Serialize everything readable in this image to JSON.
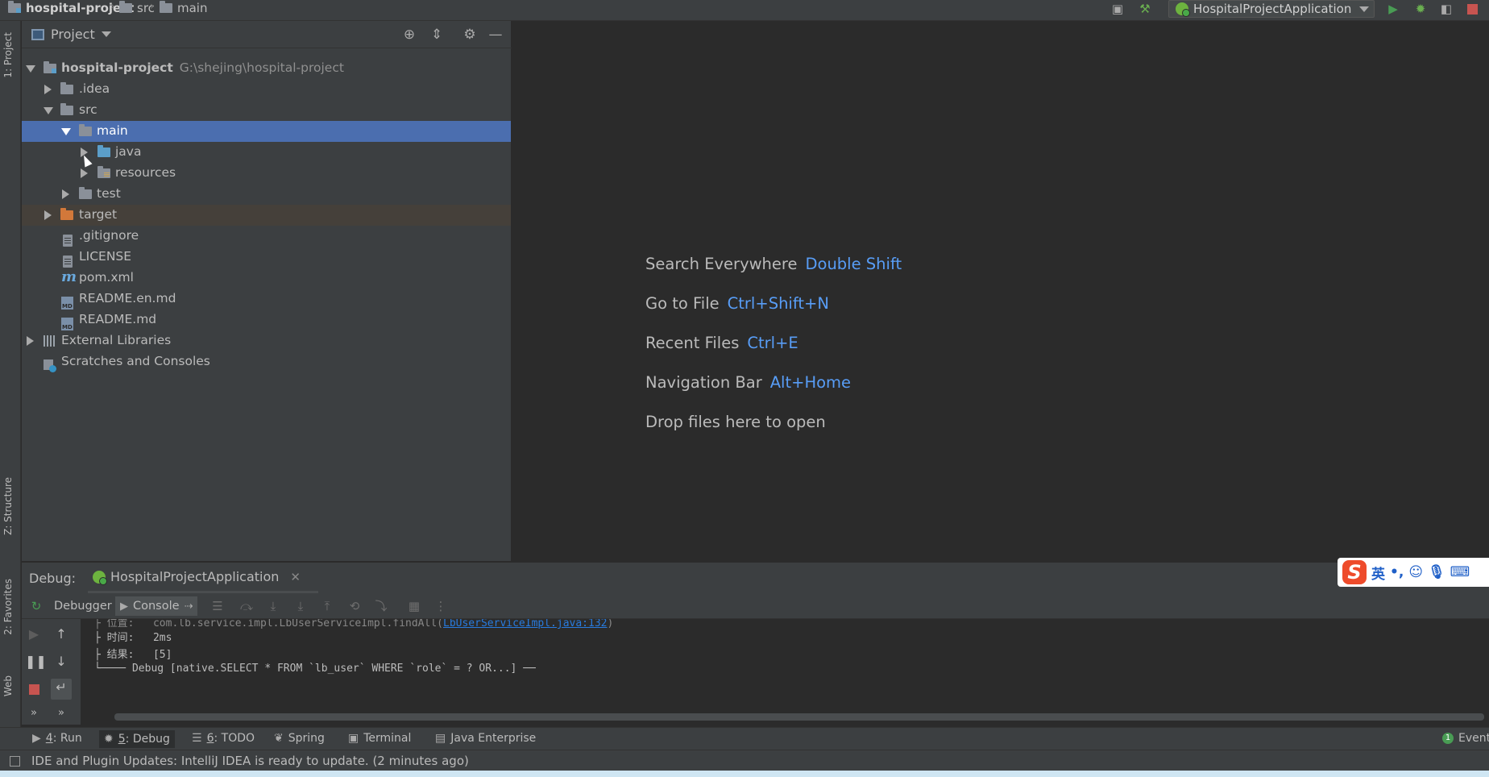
{
  "breadcrumb": {
    "project": "hospital-project",
    "src": "src",
    "main": "main"
  },
  "run_config": {
    "name": "HospitalProjectApplication"
  },
  "left_stripe": {
    "project_tab": "1: Project",
    "structure_tab": "Z: Structure",
    "favorites_tab": "2: Favorites",
    "web_tab": "Web"
  },
  "project_panel": {
    "title": "Project",
    "tree": [
      {
        "label": "hospital-project",
        "hint": "G:\\shejing\\hospital-project"
      },
      {
        "label": ".idea"
      },
      {
        "label": "src"
      },
      {
        "label": "main"
      },
      {
        "label": "java"
      },
      {
        "label": "resources"
      },
      {
        "label": "test"
      },
      {
        "label": "target"
      },
      {
        "label": ".gitignore"
      },
      {
        "label": "LICENSE"
      },
      {
        "label": "pom.xml"
      },
      {
        "label": "README.en.md"
      },
      {
        "label": "README.md"
      },
      {
        "label": "External Libraries"
      },
      {
        "label": "Scratches and Consoles"
      }
    ]
  },
  "editor_hints": [
    {
      "label": "Search Everywhere",
      "key": "Double Shift"
    },
    {
      "label": "Go to File",
      "key": "Ctrl+Shift+N"
    },
    {
      "label": "Recent Files",
      "key": "Ctrl+E"
    },
    {
      "label": "Navigation Bar",
      "key": "Alt+Home"
    },
    {
      "label": "Drop files here to open",
      "key": ""
    }
  ],
  "debug": {
    "label": "Debug:",
    "session": "HospitalProjectApplication",
    "debugger_tab": "Debugger",
    "console_tab": "Console",
    "console_lines": [
      {
        "text": "├ 时间:   2ms"
      },
      {
        "text": "├ 结果:   [5]"
      },
      {
        "text": "└──── Debug [native.SELECT * FROM `lb_user` WHERE `role` = ? OR...] ──"
      }
    ]
  },
  "bottom_tabs": {
    "run": {
      "num": "4",
      "label": ": Run"
    },
    "debug": {
      "num": "5",
      "label": ": Debug"
    },
    "todo": {
      "num": "6",
      "label": ": TODO"
    },
    "spring": "Spring",
    "terminal": "Terminal",
    "java_enterprise": "Java Enterprise",
    "event": "Event"
  },
  "status_bar": {
    "message": "IDE and Plugin Updates: IntelliJ IDEA is ready to update. (2 minutes ago)"
  },
  "ime": {
    "lang": "英",
    "punct": "•,",
    "logo": "S"
  },
  "colors": {
    "selection": "#4b6eaf",
    "shortcut": "#589df6",
    "link": "#287bde",
    "spring_green": "#6db33f",
    "stop_red": "#c75450",
    "run_green": "#499c54"
  }
}
